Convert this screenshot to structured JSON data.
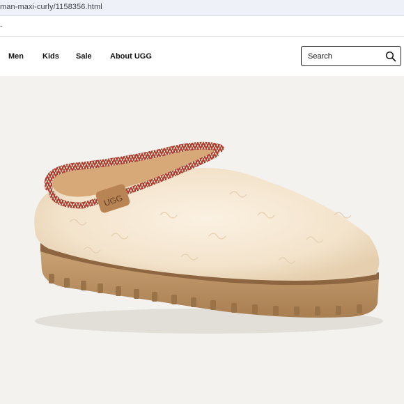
{
  "browser": {
    "url": "man-maxi-curly/1158356.html"
  },
  "promo": {
    "text": "-"
  },
  "nav": {
    "items": [
      {
        "label": "Men"
      },
      {
        "label": "Kids"
      },
      {
        "label": "Sale"
      },
      {
        "label": "About UGG"
      }
    ],
    "search_placeholder": "Search",
    "search_icon": "search-icon"
  },
  "product": {
    "image": "shearling-slipper-with-braided-trim",
    "tag_text": "UGG",
    "colors": {
      "fleece": "#f6e8d3",
      "sole": "#c49a6c",
      "braid_red": "#c8312c"
    }
  }
}
